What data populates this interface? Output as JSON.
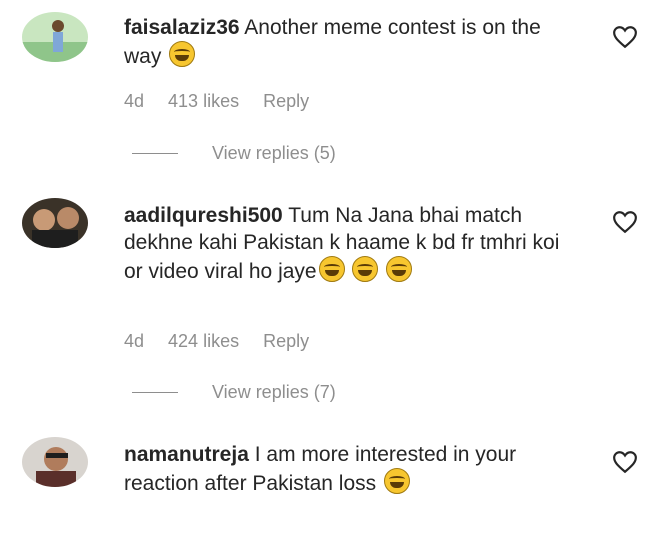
{
  "comments": [
    {
      "username": "faisalaziz36",
      "text": "Another meme contest is on the way",
      "emoji_count": 1,
      "time": "4d",
      "likes": "413 likes",
      "reply_label": "Reply",
      "view_replies": "View replies (5)"
    },
    {
      "username": "aadilqureshi500",
      "text": "Tum Na Jana bhai match dekhne kahi Pakistan k haame k bd fr tmhri koi or video viral ho jaye",
      "emoji_count": 3,
      "time": "4d",
      "likes": "424 likes",
      "reply_label": "Reply",
      "view_replies": "View replies (7)"
    },
    {
      "username": "namanutreja",
      "text": "I am more interested in your reaction after Pakistan loss",
      "emoji_count": 1
    }
  ],
  "icons": {
    "emoji": "face-with-tears-of-joy-icon",
    "like": "heart-outline-icon"
  }
}
